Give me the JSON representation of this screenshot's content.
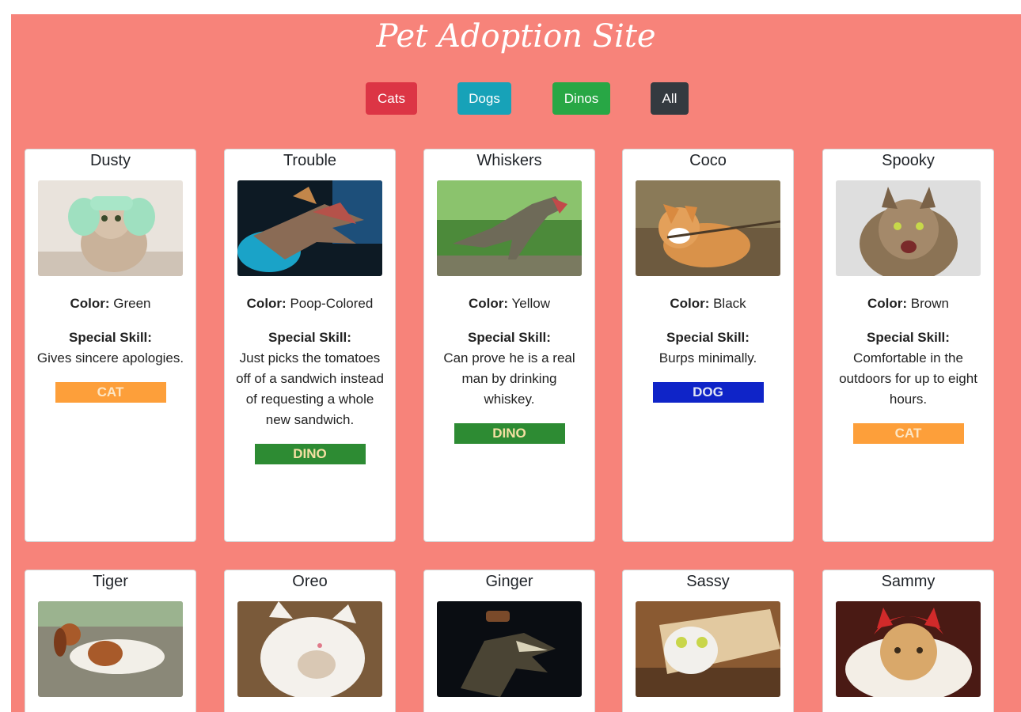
{
  "site": {
    "title": "Pet Adoption Site"
  },
  "filters": [
    {
      "label": "Cats",
      "color": "#dc3545"
    },
    {
      "label": "Dogs",
      "color": "#17a2b8"
    },
    {
      "label": "Dinos",
      "color": "#28a745"
    },
    {
      "label": "All",
      "color": "#343a40"
    }
  ],
  "labels": {
    "color": "Color:",
    "skill": "Special Skill:"
  },
  "pets": [
    {
      "name": "Dusty",
      "color": "Green",
      "skill": "Gives sincere apologies.",
      "type": "CAT"
    },
    {
      "name": "Trouble",
      "color": "Poop-Colored",
      "skill": "Just picks the tomatoes off of a sandwich instead of requesting a whole new sandwich.",
      "type": "DINO"
    },
    {
      "name": "Whiskers",
      "color": "Yellow",
      "skill": "Can prove he is a real man by drinking whiskey.",
      "type": "DINO"
    },
    {
      "name": "Coco",
      "color": "Black",
      "skill": "Burps minimally.",
      "type": "DOG"
    },
    {
      "name": "Spooky",
      "color": "Brown",
      "skill": "Comfortable in the outdoors for up to eight hours.",
      "type": "CAT"
    },
    {
      "name": "Tiger"
    },
    {
      "name": "Oreo"
    },
    {
      "name": "Ginger"
    },
    {
      "name": "Sassy"
    },
    {
      "name": "Sammy"
    }
  ],
  "type_colors": {
    "CAT": {
      "bg": "#fd9f3a",
      "fg": "#fde6c4"
    },
    "DINO": {
      "bg": "#2d8b33",
      "fg": "#f4e0a2"
    },
    "DOG": {
      "bg": "#0f24c8",
      "fg": "#e2e6f4"
    }
  },
  "photo_icons": [
    "cat-photo",
    "dinosaur-photo",
    "dinosaur-photo",
    "dog-photo",
    "cat-photo",
    "dog-photo",
    "cat-photo",
    "dinosaur-photo",
    "cat-photo",
    "cat-photo"
  ]
}
